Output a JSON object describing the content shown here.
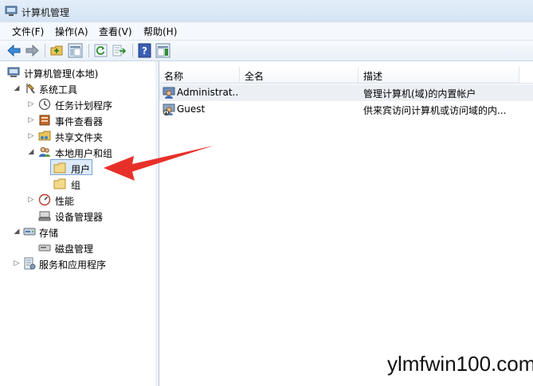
{
  "window": {
    "title": "计算机管理"
  },
  "menu": [
    "文件(F)",
    "操作(A)",
    "查看(V)",
    "帮助(H)"
  ],
  "toolbar": {
    "icons": [
      "back-arrow-icon",
      "forward-arrow-icon",
      "up-folder-icon",
      "show-hide-tree-icon",
      "refresh-icon",
      "export-list-icon",
      "help-icon",
      "action-pane-icon"
    ]
  },
  "tree": {
    "root": "计算机管理(本地)",
    "system_tools": "系统工具",
    "task_scheduler": "任务计划程序",
    "event_viewer": "事件查看器",
    "shared_folders": "共享文件夹",
    "local_users_groups": "本地用户和组",
    "users": "用户",
    "groups": "组",
    "performance": "性能",
    "device_manager": "设备管理器",
    "storage": "存储",
    "disk_management": "磁盘管理",
    "services_apps": "服务和应用程序"
  },
  "list": {
    "columns": [
      "名称",
      "全名",
      "描述"
    ],
    "rows": [
      {
        "name": "Administrat...",
        "fullname": "",
        "description": "管理计算机(域)的内置帐户"
      },
      {
        "name": "Guest",
        "fullname": "",
        "description": "供来宾访问计算机或访问域的内..."
      }
    ]
  },
  "watermark": "ylmfwin100.com",
  "colors": {
    "arrow": "#e8302a",
    "selection": "#dcebfc"
  }
}
